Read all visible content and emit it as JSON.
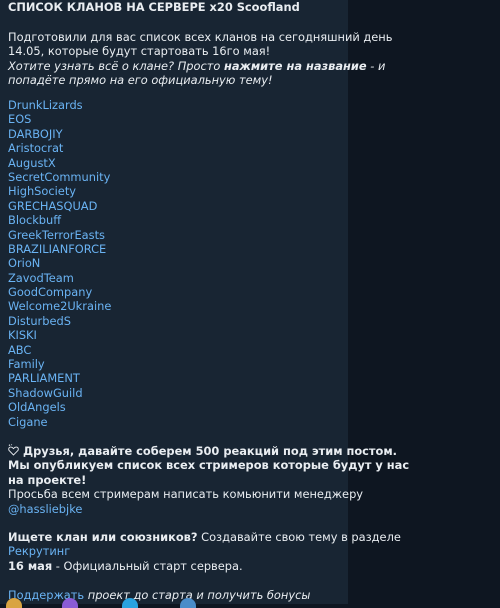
{
  "post": {
    "title": "СПИСОК КЛАНОВ НА СЕРВЕРЕ x20 Scoofland",
    "intro_line1": "Подготовили для вас список всех кланов на сегодняшний день",
    "intro_line2": "14.05, которые будут стартовать 16го мая!",
    "hint_line1_a": "Хотите узнать всё о клане? Просто ",
    "hint_line1_bold": "нажмите на название",
    "hint_line1_b": " - и",
    "hint_line2": "попадёте прямо на его официальную тему!",
    "clans": [
      "DrunkLizards",
      "EOS",
      "DARBOJIY",
      "Aristocrat",
      "AugustX",
      "SecretCommunity",
      "HighSociety",
      "GRECHASQUAD",
      "Blockbuff",
      "GreekTerrorEasts",
      "BRAZILIANFORCE",
      "OrioN",
      "ZavodTeam",
      "GoodCompany",
      "Welcome2Ukraine",
      "DisturbedS",
      "KISKI",
      "ABC",
      "Family",
      "PARLIAMENT",
      "ShadowGuild",
      "OldAngels",
      "Cigane"
    ],
    "reactions_line1": "Друзья, давайте соберем 500 реакций под этим постом.",
    "reactions_line2": "Мы опубликуем список всех стримеров которые будут у нас",
    "reactions_line3": "на проекте!",
    "streamers_line": "Просьба всем стримерам написать комьюнити менеджеру",
    "manager_link": "@hassliebjke",
    "recruit_q_bold": "Ищете клан или союзников?",
    "recruit_q_rest": " Создавайте свою тему в разделе",
    "recruit_link": "Рекрутинг",
    "start_date_bold": "16 мая",
    "start_date_rest": " - Официальный старт сервера.",
    "support_link": "Поддержать",
    "support_rest": " проект до старта и получить бонусы"
  },
  "colors": {
    "background": "#0e1621",
    "bubble": "#182533",
    "text": "#e9edf1",
    "link": "#6ab3f3"
  },
  "icons": [
    "sparkle-heart-emoji"
  ]
}
